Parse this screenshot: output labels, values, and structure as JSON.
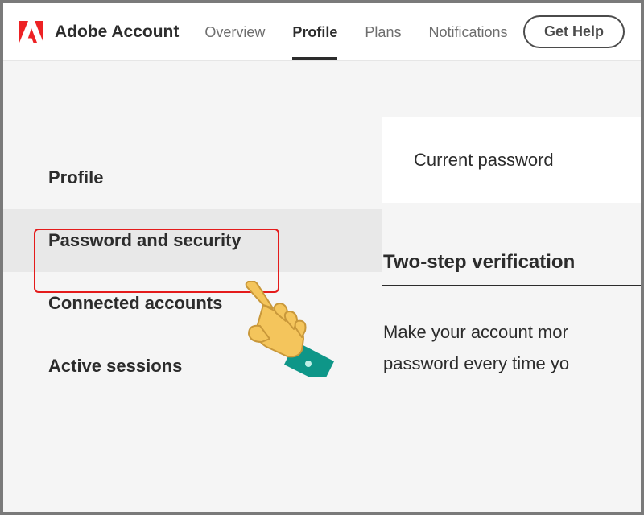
{
  "brand": "Adobe Account",
  "nav": {
    "overview": "Overview",
    "profile": "Profile",
    "plans": "Plans",
    "notifications": "Notifications",
    "get_help": "Get Help"
  },
  "sidebar": {
    "profile": "Profile",
    "password_security": "Password and security",
    "connected_accounts": "Connected accounts",
    "active_sessions": "Active sessions"
  },
  "main": {
    "current_password_label": "Current password",
    "two_step_heading": "Two-step verification",
    "two_step_desc_line1": "Make your account mor",
    "two_step_desc_line2": "password every time yo"
  },
  "colors": {
    "adobe_red": "#ed2224",
    "highlight_border": "#e41b1b"
  },
  "annotation": {
    "hand_points_to": "password_security"
  }
}
